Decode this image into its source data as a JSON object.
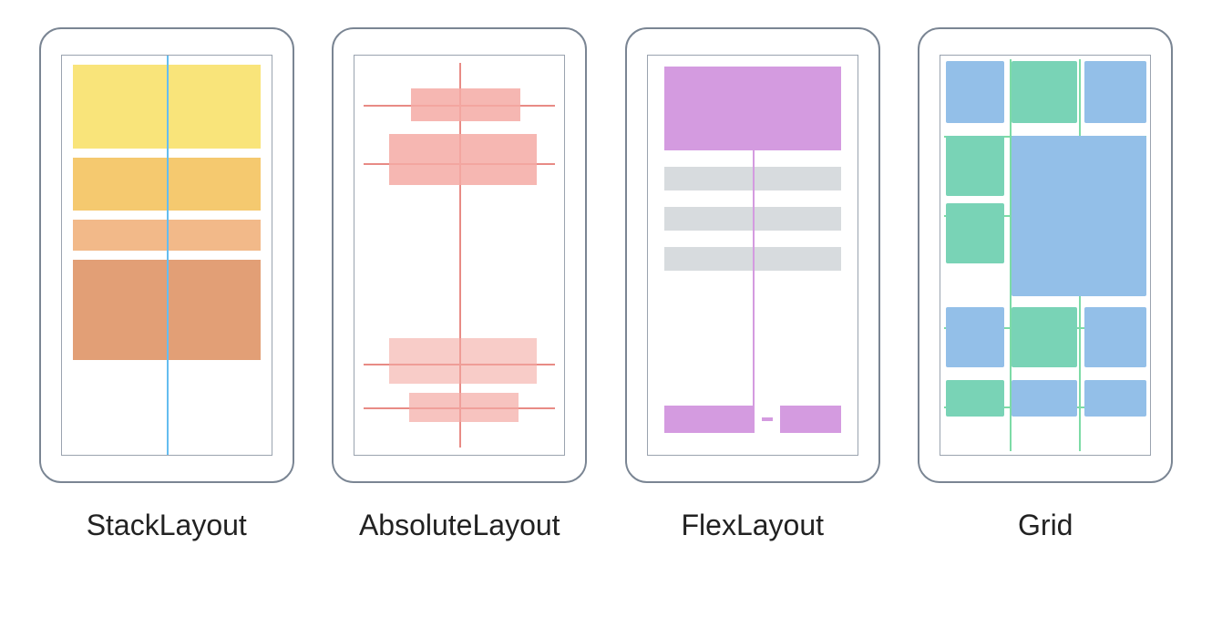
{
  "layouts": [
    {
      "name": "StackLayout"
    },
    {
      "name": "AbsoluteLayout"
    },
    {
      "name": "FlexLayout"
    },
    {
      "name": "Grid"
    }
  ],
  "colors": {
    "stack_axis": "#65bdf0",
    "stack_bars": [
      "#f9e47a",
      "#f5c96f",
      "#f2b989",
      "#e29f76"
    ],
    "absolute_accent": "#e88b85",
    "absolute_block": "#f4aaa4",
    "flex_primary": "#d49be0",
    "flex_neutral": "#d7dbde",
    "grid_line": "#7ddba6",
    "grid_blue": "#93bfe8",
    "grid_green": "#79d3b6"
  }
}
